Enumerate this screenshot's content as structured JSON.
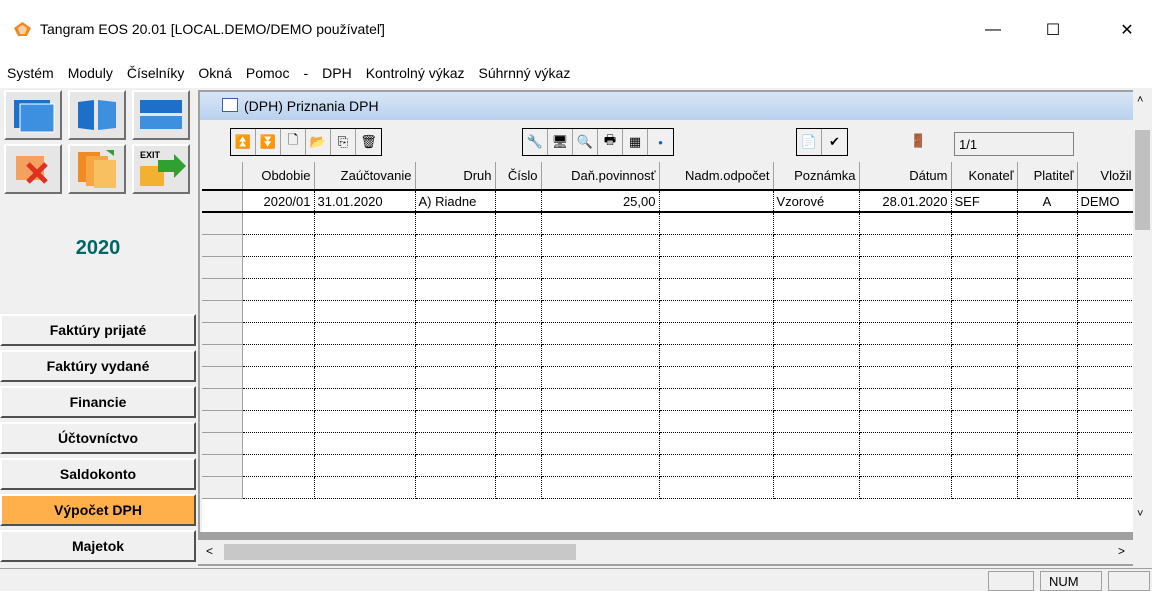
{
  "window": {
    "title": "Tangram EOS 20.01 [LOCAL.DEMO/DEMO používateľ]",
    "minimize_label": "—",
    "maximize_label": "☐",
    "close_label": "✕"
  },
  "menu": [
    "Systém",
    "Moduly",
    "Číselníky",
    "Okná",
    "Pomoc",
    "-",
    "DPH",
    "Kontrolný výkaz",
    "Súhrnný výkaz"
  ],
  "sidebar": {
    "year": "2020",
    "exit_label": "EXIT",
    "modules": [
      {
        "label": "Faktúry prijaté",
        "active": false
      },
      {
        "label": "Faktúry vydané",
        "active": false
      },
      {
        "label": "Financie",
        "active": false
      },
      {
        "label": "Účtovníctvo",
        "active": false
      },
      {
        "label": "Saldokonto",
        "active": false
      },
      {
        "label": "Výpočet DPH",
        "active": true
      },
      {
        "label": "Majetok",
        "active": false
      }
    ]
  },
  "child_window": {
    "title": "(DPH) Priznania DPH",
    "page_indicator": "1/1"
  },
  "grid": {
    "columns": [
      "Obdobie",
      "Zaúčtovanie",
      "Druh",
      "Číslo",
      "Daň.povinnosť",
      "Nadm.odpočet",
      "Poznámka",
      "Dátum",
      "Konateľ",
      "Platiteľ",
      "Vložil"
    ],
    "rows": [
      [
        "2020/01",
        "31.01.2020",
        "A) Riadne",
        "",
        "25,00",
        "",
        "Vzorové",
        "28.01.2020",
        "SEF",
        "A",
        "DEMO"
      ]
    ]
  },
  "statusbar": {
    "num": "NUM"
  },
  "colors": {
    "active_module": "#ffb04a",
    "year_text": "#006666"
  }
}
